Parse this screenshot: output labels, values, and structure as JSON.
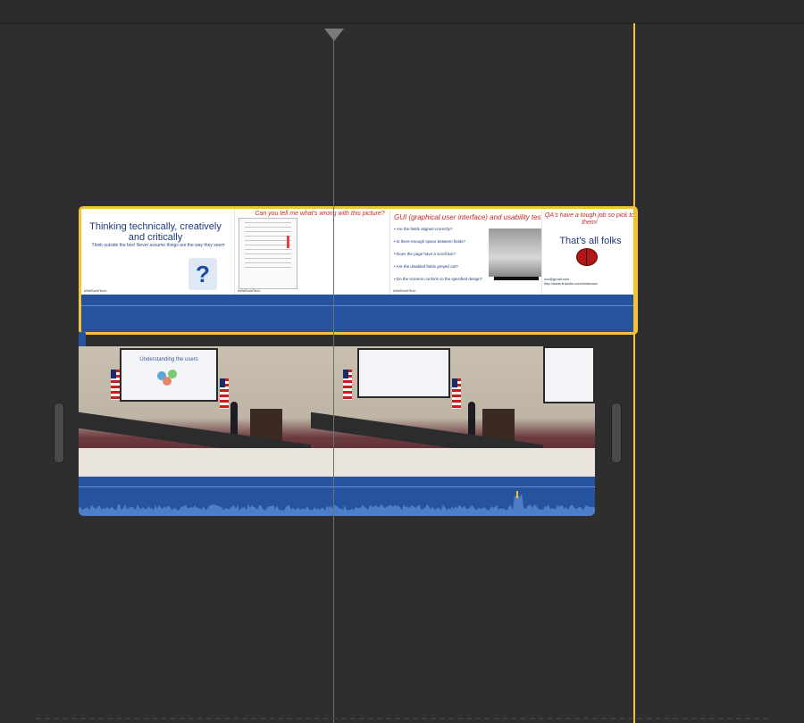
{
  "timeline": {
    "clips": {
      "slides": {
        "slide1": {
          "title": "Thinking technically, creatively and critically",
          "subtitle": "Think outside the box! Never assume things are the way they seem",
          "tag": "#WeBuildTech"
        },
        "slide2": {
          "title": "Can you tell me what's wrong with this picture?",
          "tag": "#WeBuildTech"
        },
        "slide3": {
          "title": "GUI (graphical user interface) and usability testing",
          "bullets": [
            "Are the fields aligned correctly?",
            "Is there enough space between fields?",
            "Does the page have a scroll bar?",
            "Are the disabled fields greyed out?",
            "Do the screens conform to the specified design?"
          ],
          "tag": "#WeBuildTech"
        },
        "slide4": {
          "title": "QA's have a tough job so pick to them!",
          "body": "That's all folks",
          "link1": "xxx@gmail.com",
          "link2": "http://www.linkedin.com/in/steamv"
        }
      },
      "video": {
        "screen_title": "Understanding the users"
      }
    }
  }
}
